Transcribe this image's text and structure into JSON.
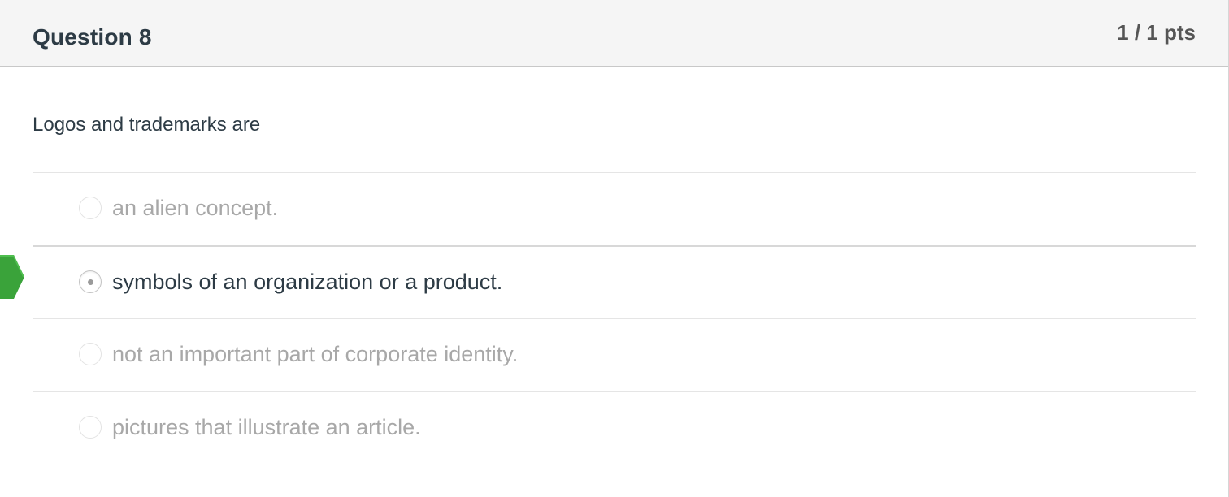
{
  "question": {
    "title": "Question 8",
    "points": "1 / 1 pts",
    "text": "Logos and trademarks are"
  },
  "answers": [
    {
      "label": "an alien concept.",
      "selected": false
    },
    {
      "label": "symbols of an organization or a product.",
      "selected": true
    },
    {
      "label": "not an important part of corporate identity.",
      "selected": false
    },
    {
      "label": "pictures that illustrate an article.",
      "selected": false
    }
  ],
  "indicator": {
    "icon": "correct-answer-arrow-icon",
    "color": "#3aa33a"
  }
}
